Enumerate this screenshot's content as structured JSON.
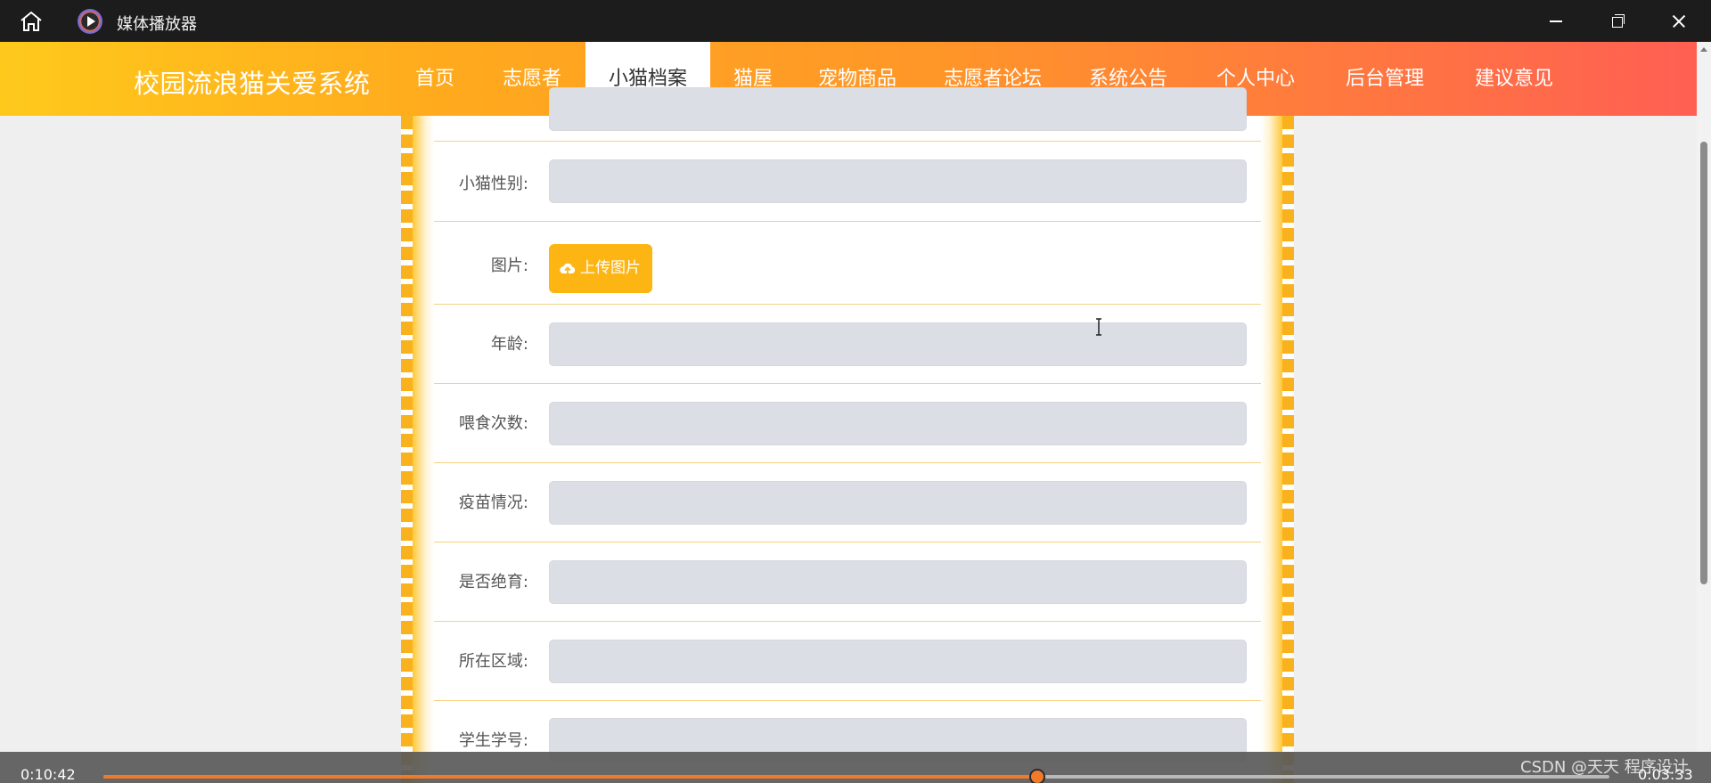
{
  "player": {
    "title": "媒体播放器",
    "current_time": "0:10:42",
    "total_time": "0:03:33",
    "progress": 0.62,
    "watermark": "CSDN @天天 程序设计"
  },
  "site": {
    "brand": "校园流浪猫关爱系统",
    "nav": [
      "首页",
      "志愿者",
      "小猫档案",
      "猫屋",
      "宠物商品",
      "志愿者论坛",
      "系统公告",
      "个人中心",
      "后台管理",
      "建议意见"
    ],
    "active_nav": "小猫档案"
  },
  "form": {
    "fields": [
      {
        "label": "",
        "type": "input",
        "value": ""
      },
      {
        "label": "小猫性别:",
        "type": "input",
        "value": ""
      },
      {
        "label": "图片:",
        "type": "upload",
        "button": "上传图片"
      },
      {
        "label": "年龄:",
        "type": "input",
        "value": ""
      },
      {
        "label": "喂食次数:",
        "type": "input",
        "value": ""
      },
      {
        "label": "疫苗情况:",
        "type": "input",
        "value": ""
      },
      {
        "label": "是否绝育:",
        "type": "input",
        "value": ""
      },
      {
        "label": "所在区域:",
        "type": "input",
        "value": ""
      },
      {
        "label": "学生学号:",
        "type": "input",
        "value": ""
      }
    ]
  },
  "colors": {
    "nav_start": "#ffc91c",
    "nav_end": "#ff5f53",
    "accent": "#fdb514",
    "progress": "#f07a2a"
  }
}
